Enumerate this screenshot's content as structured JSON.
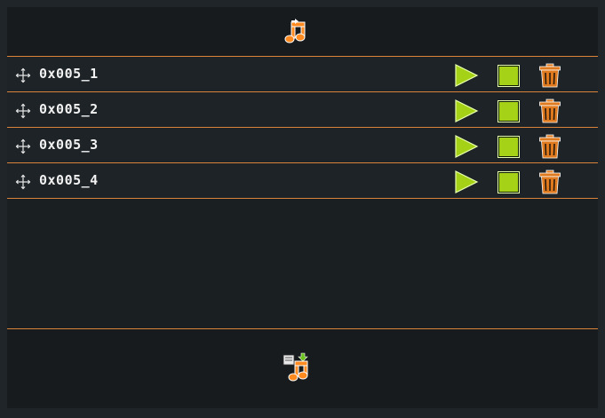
{
  "header": {
    "icon": "music-import-icon"
  },
  "tracks": [
    {
      "name": "0x005_1"
    },
    {
      "name": "0x005_2"
    },
    {
      "name": "0x005_3"
    },
    {
      "name": "0x005_4"
    }
  ],
  "row_icons": {
    "drag": "move-arrows-icon",
    "play": "play-icon",
    "stop": "stop-icon",
    "delete": "trash-icon"
  },
  "footer": {
    "icon": "music-export-icon"
  },
  "colors": {
    "accent": "#d9823a",
    "play_green": "#a5d116",
    "background": "#1f2529",
    "text": "#f2f2f2"
  }
}
